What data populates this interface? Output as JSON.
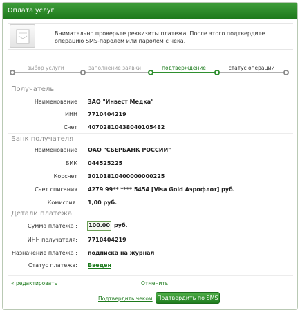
{
  "header": {
    "title": "Оплата услуг"
  },
  "info": {
    "text": "Внимательно проверьте реквизиты платежа. После этого подтвердите операцию SMS-паролем или паролем с чека."
  },
  "steps": [
    {
      "label": "выбор услуги",
      "state": "done"
    },
    {
      "label": "заполнение заявки",
      "state": "done"
    },
    {
      "label": "подтверждение",
      "state": "current"
    },
    {
      "label": "статус операции",
      "state": "pending"
    }
  ],
  "recipient": {
    "title": "Получатель",
    "fields": [
      {
        "label": "Наименование",
        "value": "ЗАО \"Инвест Медка\""
      },
      {
        "label": "ИНН",
        "value": "7710404219"
      },
      {
        "label": "Счет",
        "value": "40702810438040105482"
      }
    ]
  },
  "bank": {
    "title": "Банк получателя",
    "fields": [
      {
        "label": "Наименование",
        "value": "ОАО \"СБЕРБАНК РОССИИ\""
      },
      {
        "label": "БИК",
        "value": "044525225"
      },
      {
        "label": "Корсчет",
        "value": "30101810400000000225"
      },
      {
        "label": "Счет списания",
        "value": "4279 99** **** 5454  [Visa Gold Аэрофлот]  руб."
      },
      {
        "label": "Комиссия:",
        "value": "1,00 руб."
      }
    ]
  },
  "details": {
    "title": "Детали платежа",
    "amount_label": "Сумма платежа :",
    "amount_value": "100.00",
    "amount_currency": "руб.",
    "inn_label": "ИНН получателя:",
    "inn_value": "7710404219",
    "purpose_label": "Назначение платежа :",
    "purpose_value": "подписка на журнал",
    "status_label": "Статус платежа:",
    "status_value": "Введен"
  },
  "actions": {
    "edit": "« редактировать",
    "cancel": "Отменить",
    "confirm_check": "Подтвердить чеком",
    "confirm_sms": "Подтвердить по SMS"
  },
  "colors": {
    "accent": "#1f7d1f",
    "done": "#8a8a8a",
    "pending": "#8a8a8a"
  }
}
